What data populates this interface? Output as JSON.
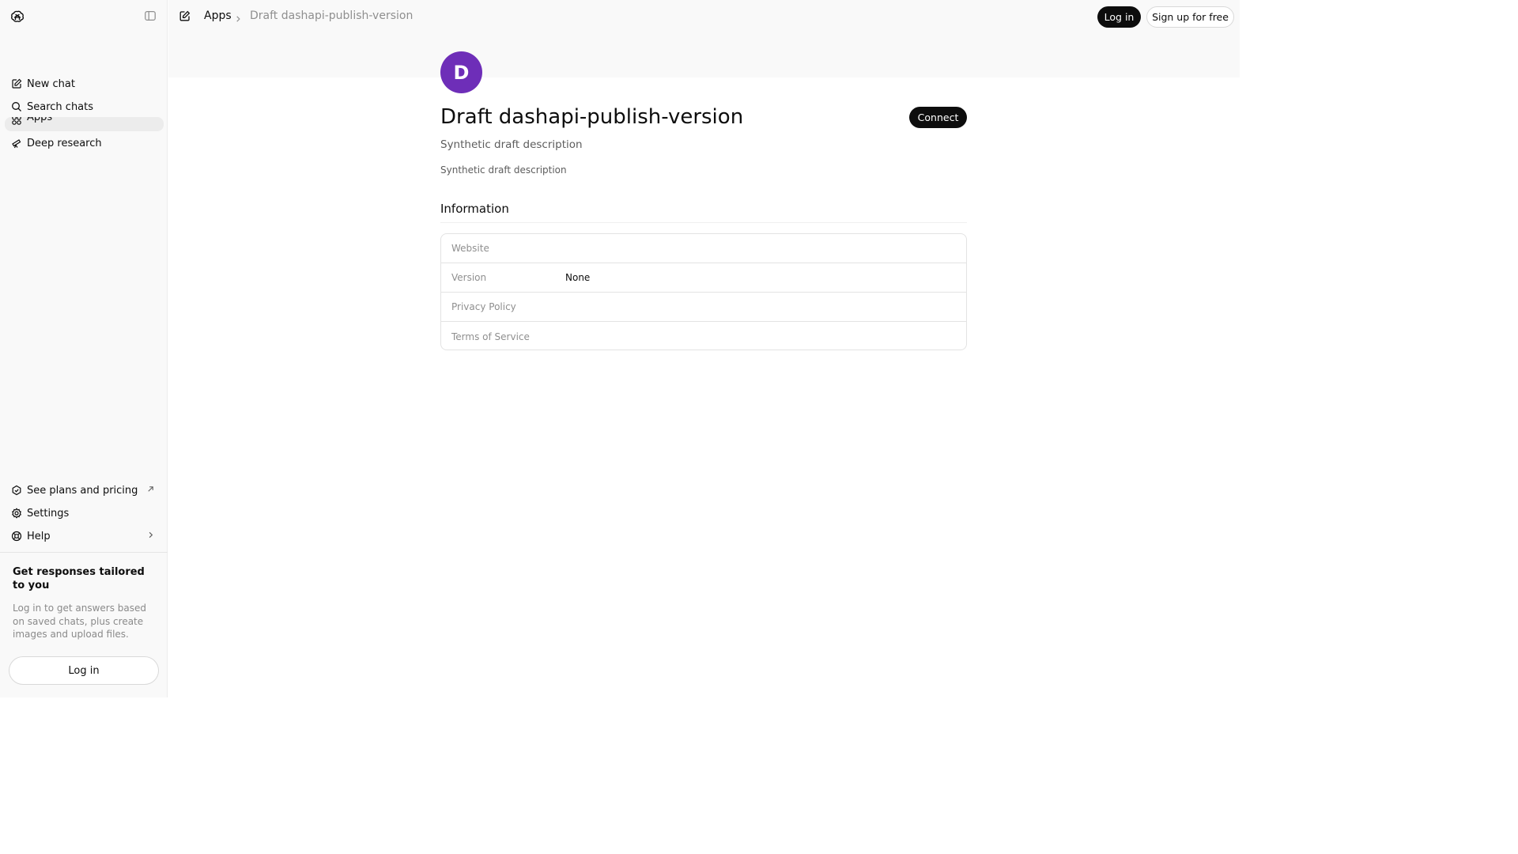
{
  "sidebar": {
    "nav": {
      "new_chat": "New chat",
      "search_chats": "Search chats",
      "apps": "Apps",
      "deep_research": "Deep research"
    },
    "bottom": {
      "plans": "See plans and pricing",
      "settings": "Settings",
      "help": "Help"
    },
    "promo": {
      "title": "Get responses tailored to you",
      "text": "Log in to get answers based on saved chats, plus create images and upload files.",
      "login_label": "Log in"
    }
  },
  "header": {
    "breadcrumb_root": "Apps",
    "breadcrumb_current": "Draft dashapi-publish-version",
    "login_label": "Log in",
    "signup_label": "Sign up for free"
  },
  "app": {
    "avatar_letter": "D",
    "avatar_color": "#6e2eb8",
    "title": "Draft dashapi-publish-version",
    "subtitle": "Synthetic draft description",
    "description": "Synthetic draft description",
    "connect_label": "Connect"
  },
  "information": {
    "heading": "Information",
    "rows": [
      {
        "label": "Website",
        "value": ""
      },
      {
        "label": "Version",
        "value": "None"
      },
      {
        "label": "Privacy Policy",
        "value": ""
      },
      {
        "label": "Terms of Service",
        "value": ""
      }
    ]
  },
  "icons": {
    "logo": "openai-logo-icon",
    "sidebar_toggle": "sidebar-toggle-icon",
    "new_chat": "edit-icon",
    "search": "search-icon",
    "apps": "apps-icon",
    "deep_research": "telescope-icon",
    "plans": "upgrade-icon",
    "settings": "gear-icon",
    "help": "help-icon"
  }
}
